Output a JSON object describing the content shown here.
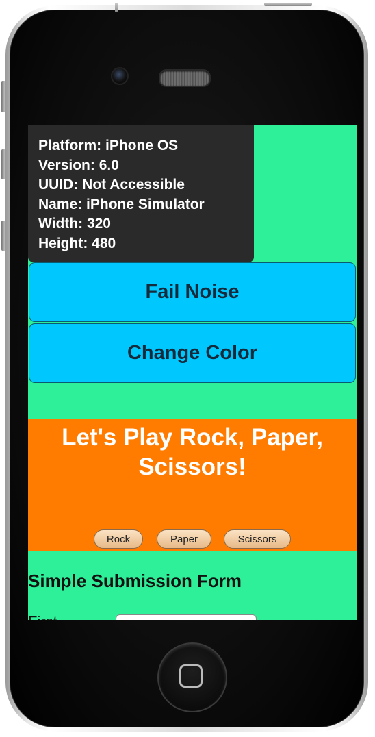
{
  "device_info": {
    "platform": "Platform: iPhone OS",
    "version": "Version: 6.0",
    "uuid": "UUID: Not Accessible",
    "name": "Name: iPhone Simulator",
    "width": "Width: 320",
    "height": "Height: 480"
  },
  "buttons": {
    "fail_noise": "Fail Noise",
    "change_color": "Change Color"
  },
  "game": {
    "title": "Let's Play Rock, Paper, Scissors!",
    "rock": "Rock",
    "paper": "Paper",
    "scissors": "Scissors"
  },
  "form": {
    "title": "Simple Submission Form",
    "first_label": "First",
    "first_value": ""
  },
  "colors": {
    "screen_background": "#2ef098",
    "button_blue": "#00c8ff",
    "game_orange": "#ff7c00",
    "info_box": "#2a2a2a"
  }
}
